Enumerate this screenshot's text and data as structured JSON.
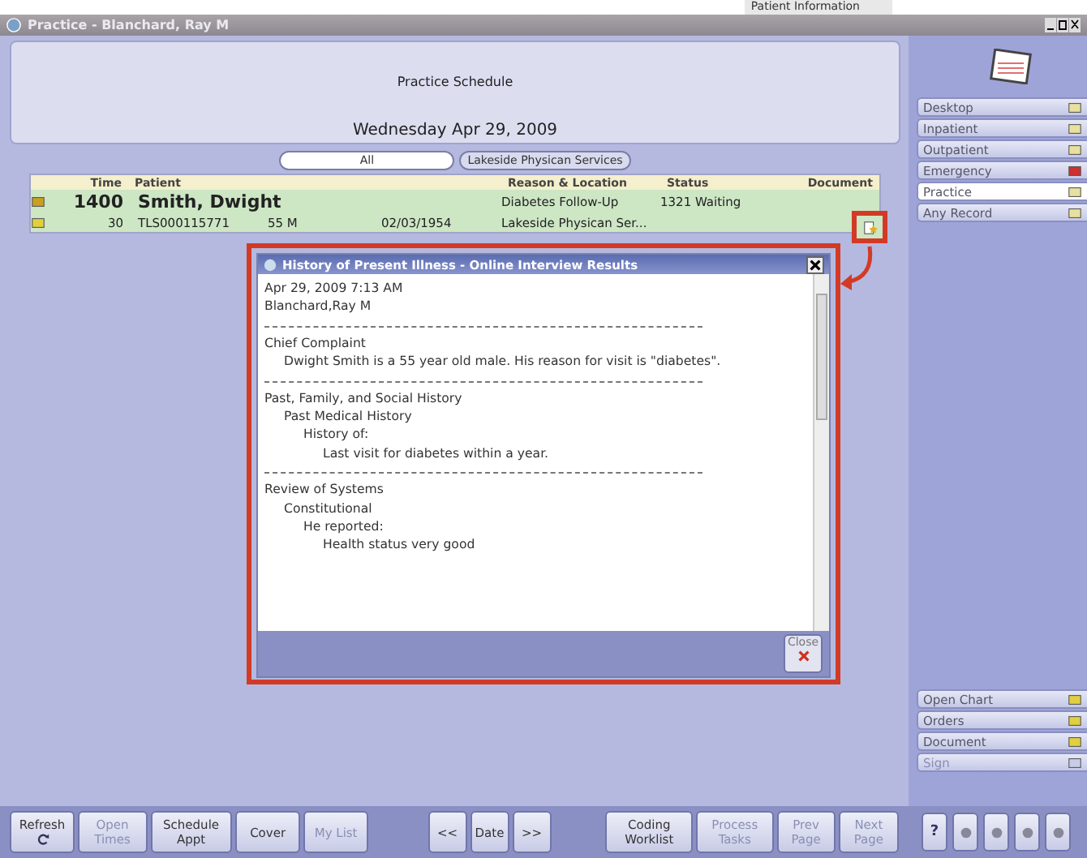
{
  "top_tab": "Patient Information",
  "window": {
    "title": "Practice - Blanchard, Ray M"
  },
  "header": {
    "title": "Practice Schedule",
    "date": "Wednesday Apr 29, 2009"
  },
  "filters": [
    {
      "label": "All",
      "selected": true
    },
    {
      "label": "Lakeside Physican Services",
      "selected": false
    }
  ],
  "table": {
    "columns": [
      "Time",
      "Patient",
      "Reason & Location",
      "Status",
      "Document"
    ],
    "rows": [
      {
        "time": "1400",
        "patient": "Smith, Dwight",
        "reason": "Diabetes Follow-Up",
        "status": "1321 Waiting",
        "duration": "30",
        "mrn": "TLS000115771",
        "age_sex": "55 M",
        "dob": "02/03/1954",
        "location": "Lakeside Physican Ser...",
        "highlighted": true
      }
    ]
  },
  "popup": {
    "title": "History of Present Illness - Online Interview Results",
    "content": [
      {
        "kind": "line",
        "text": "Apr 29, 2009 7:13 AM"
      },
      {
        "kind": "line",
        "text": "Blanchard,Ray M"
      },
      {
        "kind": "rule"
      },
      {
        "kind": "line",
        "text": "Chief Complaint",
        "children": [
          {
            "kind": "line",
            "text": "Dwight Smith is a 55 year old male. His reason for visit is \"diabetes\"."
          }
        ]
      },
      {
        "kind": "rule"
      },
      {
        "kind": "line",
        "text": "Past, Family, and Social History",
        "children": [
          {
            "kind": "line",
            "text": "Past Medical History",
            "children": [
              {
                "kind": "line",
                "text": "History of:",
                "children": [
                  {
                    "kind": "line",
                    "text": "Last visit for diabetes within a year."
                  }
                ]
              }
            ]
          }
        ]
      },
      {
        "kind": "rule"
      },
      {
        "kind": "line",
        "text": "Review of Systems",
        "children": [
          {
            "kind": "line",
            "text": "Constitutional",
            "children": [
              {
                "kind": "line",
                "text": "He reported:",
                "children": [
                  {
                    "kind": "line",
                    "text": "Health status very good"
                  }
                ]
              }
            ]
          }
        ]
      }
    ],
    "close": "Close"
  },
  "sidebar": {
    "nav": [
      {
        "label": "Desktop",
        "selected": false
      },
      {
        "label": "Inpatient",
        "selected": false
      },
      {
        "label": "Outpatient",
        "selected": false
      },
      {
        "label": "Emergency",
        "selected": false
      },
      {
        "label": "Practice",
        "selected": true
      },
      {
        "label": "Any Record",
        "selected": false
      }
    ],
    "actions": [
      {
        "label": "Open Chart",
        "disabled": false
      },
      {
        "label": "Orders",
        "disabled": false
      },
      {
        "label": "Document",
        "disabled": false
      },
      {
        "label": "Sign",
        "disabled": true
      }
    ],
    "help": "?"
  },
  "toolbar": {
    "left": [
      {
        "label": "Refresh",
        "disabled": false,
        "icon": true
      },
      {
        "label": "Open Times",
        "disabled": true
      },
      {
        "label": "Schedule Appt",
        "disabled": false
      },
      {
        "label": "Cover",
        "disabled": false
      },
      {
        "label": "My List",
        "disabled": true
      }
    ],
    "middle": [
      {
        "label": "<<",
        "disabled": false
      },
      {
        "label": "Date",
        "disabled": false
      },
      {
        "label": ">>",
        "disabled": false
      }
    ],
    "right": [
      {
        "label": "Coding Worklist",
        "disabled": false
      },
      {
        "label": "Process Tasks",
        "disabled": true
      },
      {
        "label": "Prev Page",
        "disabled": true
      },
      {
        "label": "Next Page",
        "disabled": true
      }
    ]
  }
}
